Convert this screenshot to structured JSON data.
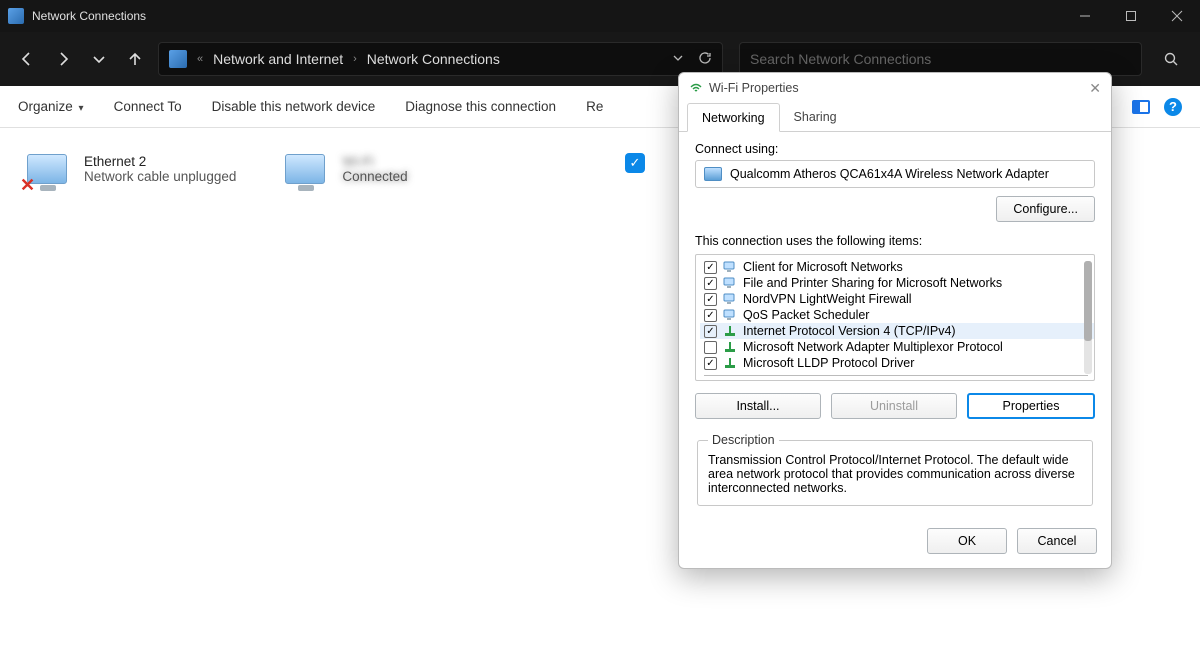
{
  "window": {
    "title": "Network Connections"
  },
  "breadcrumb": {
    "seg1": "Network and Internet",
    "seg2": "Network Connections",
    "chev_label": "«"
  },
  "search": {
    "placeholder": "Search Network Connections"
  },
  "cmd": {
    "organize": "Organize",
    "connect_to": "Connect To",
    "disable": "Disable this network device",
    "diagnose": "Diagnose this connection",
    "rename_truncated": "Re"
  },
  "connections": {
    "eth": {
      "name": "Ethernet 2",
      "status": "Network cable unplugged"
    },
    "wifi": {
      "name": "Wi-Fi",
      "status": "Connected"
    }
  },
  "dialog": {
    "title": "Wi-Fi Properties",
    "tabs": {
      "networking": "Networking",
      "sharing": "Sharing"
    },
    "connect_using": "Connect using:",
    "adapter": "Qualcomm Atheros QCA61x4A Wireless Network Adapter",
    "configure": "Configure...",
    "items_label": "This connection uses the following items:",
    "items": [
      {
        "checked": true,
        "label": "Client for Microsoft Networks",
        "icon": "net"
      },
      {
        "checked": true,
        "label": "File and Printer Sharing for Microsoft Networks",
        "icon": "net"
      },
      {
        "checked": true,
        "label": "NordVPN LightWeight Firewall",
        "icon": "net"
      },
      {
        "checked": true,
        "label": "QoS Packet Scheduler",
        "icon": "net"
      },
      {
        "checked": true,
        "label": "Internet Protocol Version 4 (TCP/IPv4)",
        "icon": "proto",
        "selected": true
      },
      {
        "checked": false,
        "label": "Microsoft Network Adapter Multiplexor Protocol",
        "icon": "proto"
      },
      {
        "checked": true,
        "label": "Microsoft LLDP Protocol Driver",
        "icon": "proto"
      }
    ],
    "install": "Install...",
    "uninstall": "Uninstall",
    "properties": "Properties",
    "desc_label": "Description",
    "desc_text": "Transmission Control Protocol/Internet Protocol. The default wide area network protocol that provides communication across diverse interconnected networks.",
    "ok": "OK",
    "cancel": "Cancel"
  }
}
